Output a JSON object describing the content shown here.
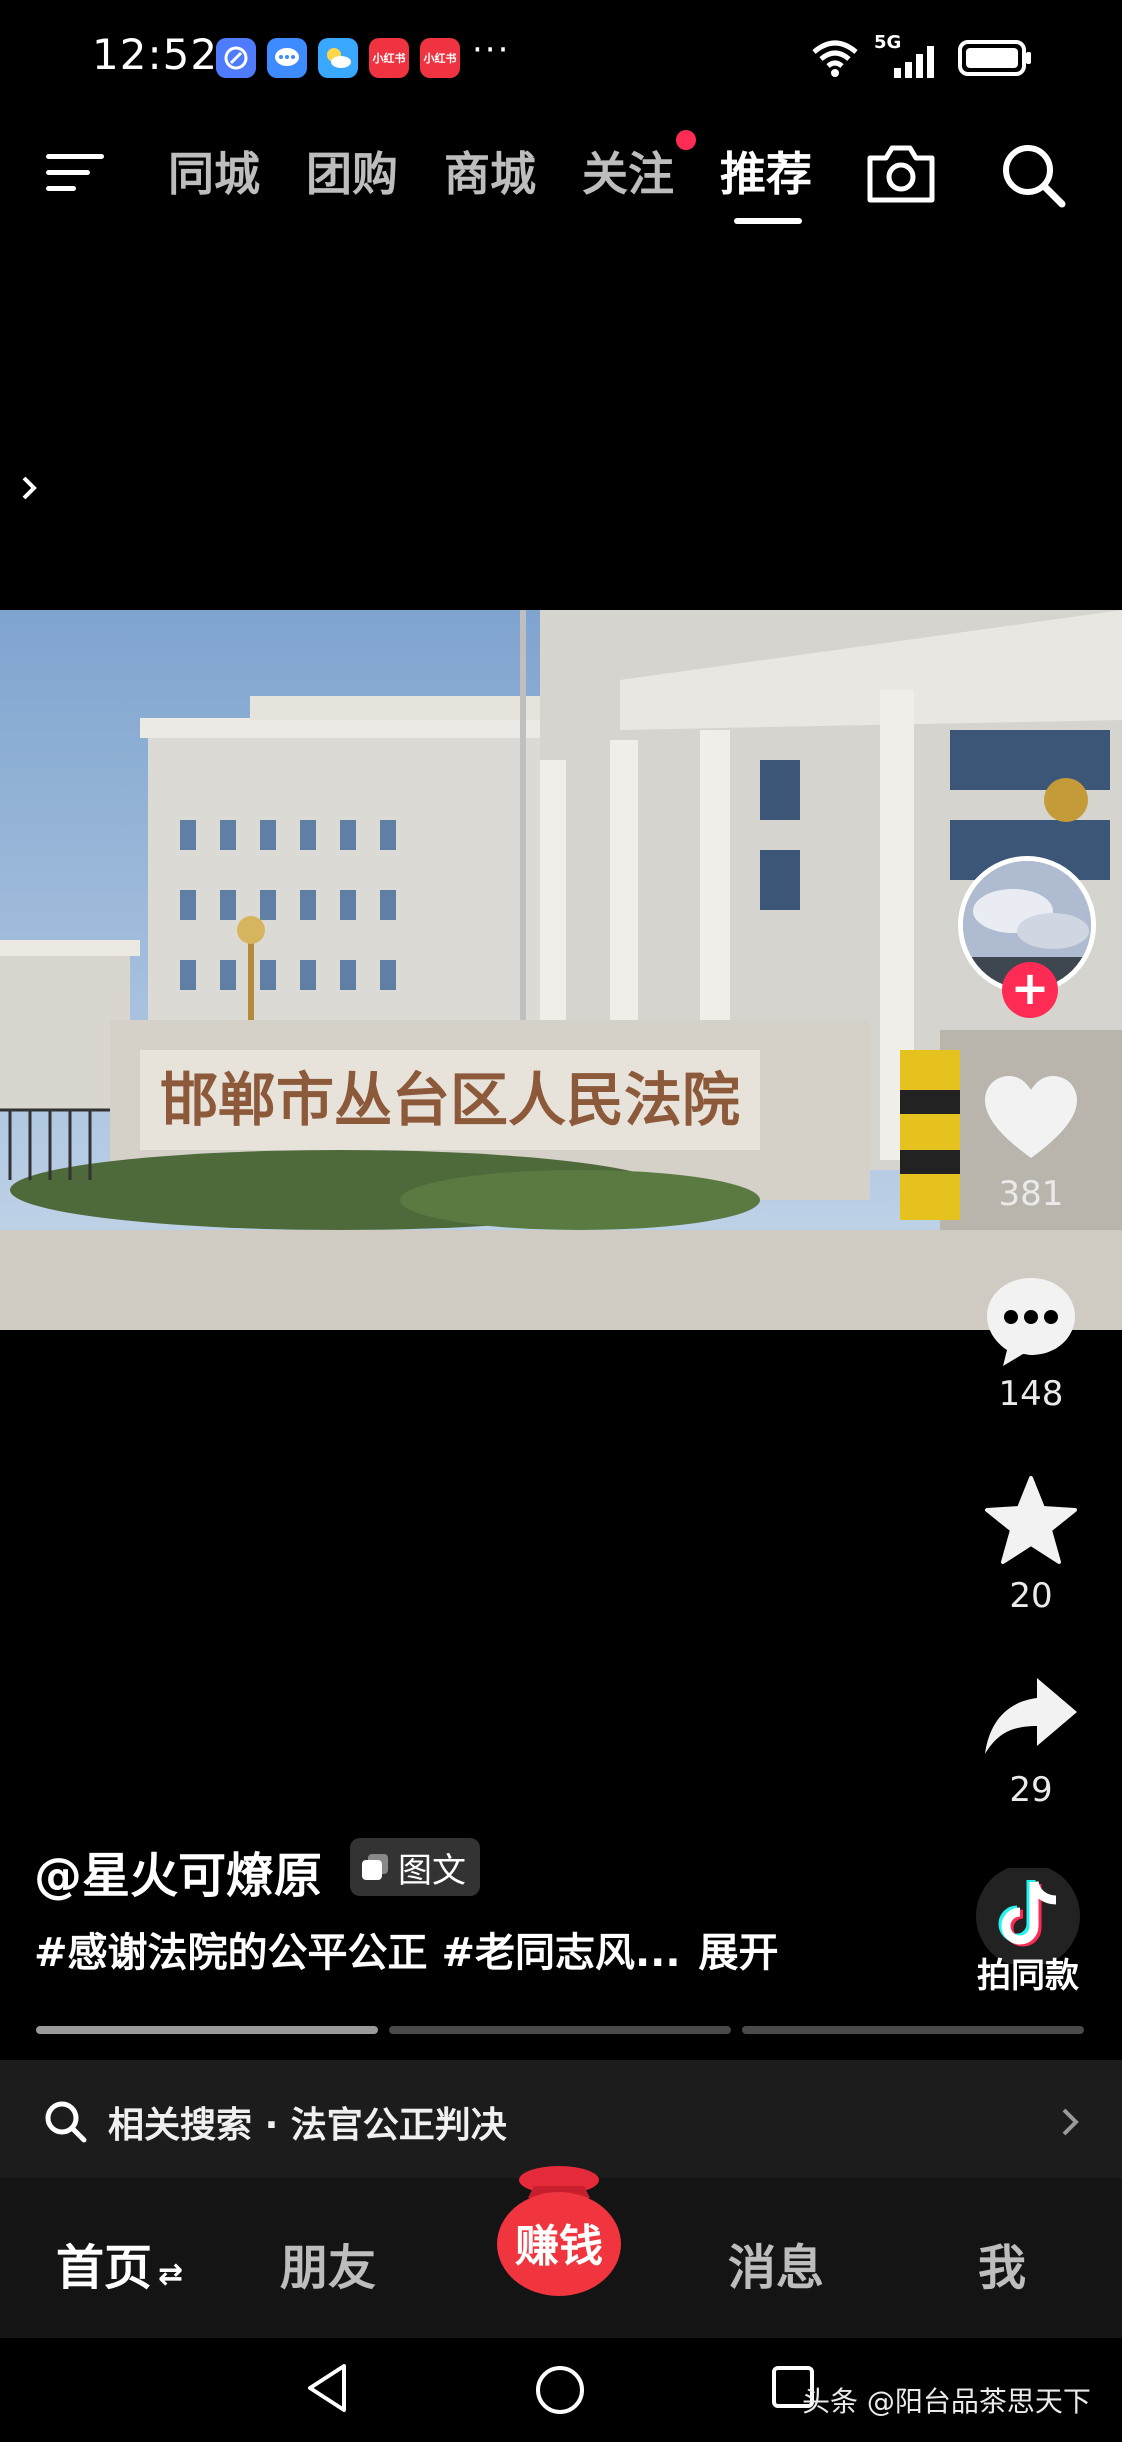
{
  "status_bar": {
    "time": "12:52",
    "notification_icons": [
      "browser-icon",
      "messages-icon",
      "weather-icon",
      "xiaohongshu-icon",
      "xiaohongshu-icon"
    ],
    "notification_labels": [
      "小红书",
      "小红书"
    ],
    "more": "···",
    "network": "5G"
  },
  "top_nav": {
    "tabs": [
      "同城",
      "团购",
      "商城",
      "关注",
      "推荐"
    ],
    "active_tab": "推荐"
  },
  "photo": {
    "sign_text": "邯郸市丛台区人民法院"
  },
  "actions": {
    "likes": "381",
    "comments": "148",
    "favorites": "20",
    "shares": "29"
  },
  "caption": {
    "author": "@星火可燎原",
    "type_tag": "图文",
    "hashtags": "#感谢法院的公平公正 #老同志风...",
    "expand": "展开"
  },
  "remix": {
    "label": "拍同款"
  },
  "progress": {
    "segments": 3,
    "active_index": 0
  },
  "related_search": {
    "prefix": "相关搜索",
    "separator": "·",
    "query": "法官公正判决"
  },
  "bottom_tabs": {
    "home": "首页",
    "friends": "朋友",
    "earn": "赚钱",
    "messages": "消息",
    "me": "我"
  },
  "watermark": "头条 @阳台品茶思天下",
  "colors": {
    "accent_red": "#fe2c55",
    "background": "#000000",
    "bottom_bar": "#141414"
  }
}
